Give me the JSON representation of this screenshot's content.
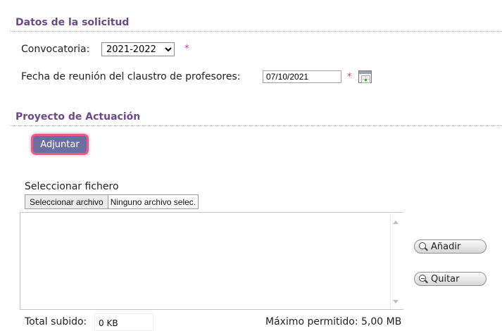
{
  "solicitud": {
    "section_title": "Datos de la solicitud",
    "convocatoria_label": "Convocatoria:",
    "convocatoria_value": "2021-2022",
    "fecha_label": "Fecha de reunión del claustro de profesores:",
    "fecha_value": "07/10/2021",
    "required_marker": "*",
    "calendar_icon": "calendar-icon"
  },
  "proyecto": {
    "section_title": "Proyecto de Actuación",
    "adjuntar_label": "Adjuntar",
    "file_label": "Seleccionar fichero",
    "file_button": "Seleccionar archivo",
    "file_status": "Ninguno archivo selec.",
    "anadir_label": "Añadir",
    "quitar_label": "Quitar",
    "anadir_icon": "zoom-in-icon",
    "quitar_icon": "zoom-out-icon",
    "total_label": "Total subido:",
    "total_value": "0 KB",
    "max_label": "Máximo permitido: 5,00 MB"
  },
  "colors": {
    "section_title": "#6b4a8a",
    "required": "#c0398a",
    "adjuntar_bg": "#6d6ea0",
    "adjuntar_border": "#e85a8a"
  }
}
